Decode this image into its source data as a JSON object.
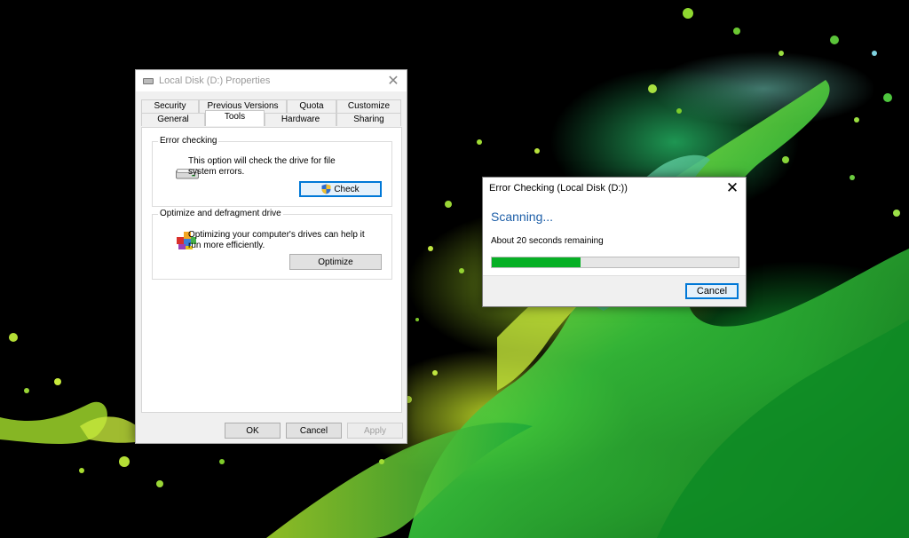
{
  "properties_window": {
    "title": "Local Disk (D:) Properties",
    "tabs_top": [
      "Security",
      "Previous Versions",
      "Quota",
      "Customize"
    ],
    "tabs_bottom": [
      "General",
      "Tools",
      "Hardware",
      "Sharing"
    ],
    "active_tab": "Tools",
    "error_checking": {
      "group_label": "Error checking",
      "description": "This option will check the drive for file system errors.",
      "check_button": "Check"
    },
    "optimize": {
      "group_label": "Optimize and defragment drive",
      "description": "Optimizing your computer's drives can help it run more efficiently.",
      "optimize_button": "Optimize"
    },
    "footer": {
      "ok": "OK",
      "cancel": "Cancel",
      "apply": "Apply"
    }
  },
  "error_dialog": {
    "title": "Error Checking (Local Disk (D:))",
    "status": "Scanning...",
    "remaining": "About 20 seconds remaining",
    "progress_fraction": 0.36,
    "cancel_button": "Cancel"
  },
  "colors": {
    "progress_green": "#06b025",
    "scan_blue": "#1e5fa8",
    "focus_blue": "#0078d7"
  }
}
